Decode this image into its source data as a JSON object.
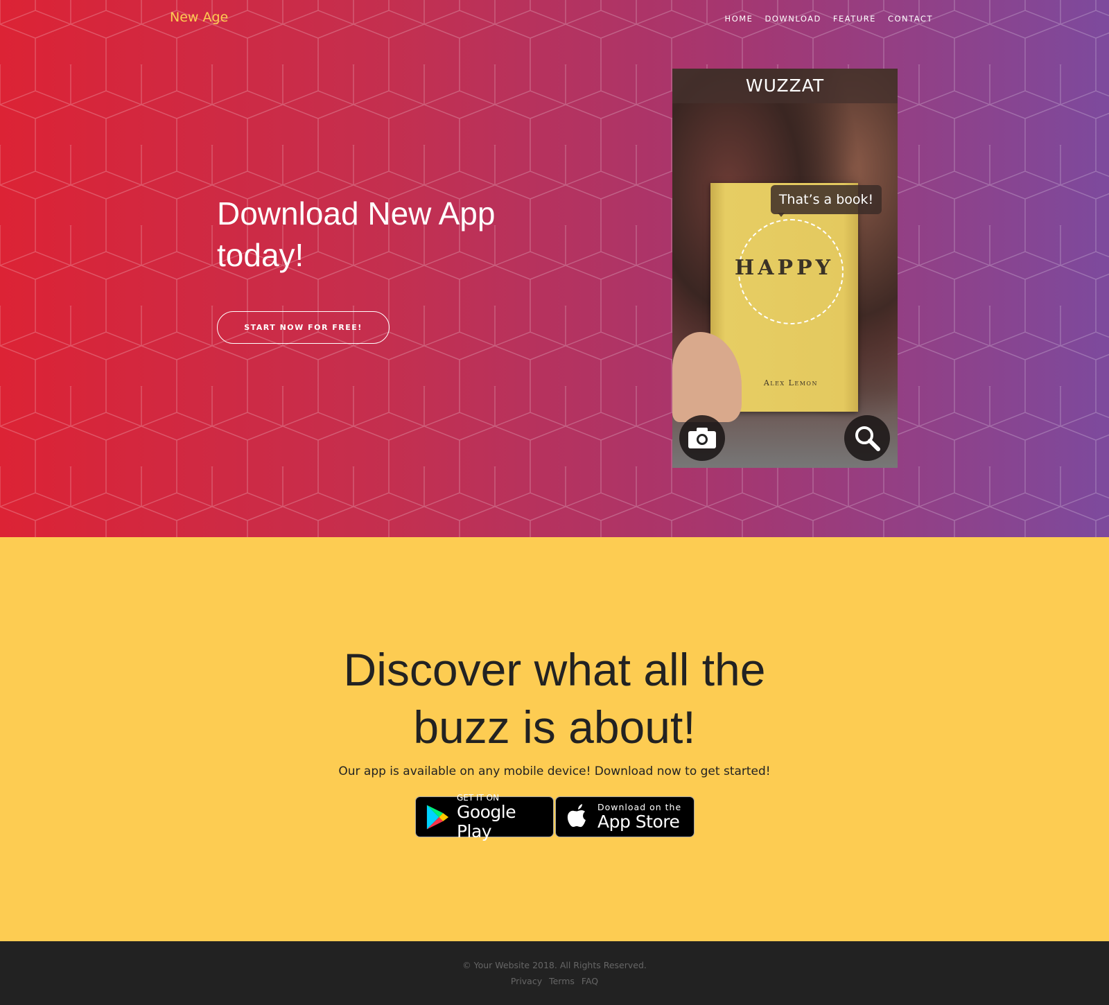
{
  "nav": {
    "brand": "New Age",
    "links": [
      "Home",
      "Download",
      "Feature",
      "Contact"
    ]
  },
  "hero": {
    "heading": "Download New App today!",
    "cta": "Start Now for Free!",
    "phone": {
      "app_name": "WUZZAT",
      "bubble": "That’s a book!",
      "book_title": "HAPPY",
      "book_author": "Alex Lemon"
    }
  },
  "download": {
    "heading": "Discover what all the buzz is about!",
    "text": "Our app is available on any mobile device! Download now to get started!",
    "google": {
      "small": "GET IT ON",
      "big": "Google Play"
    },
    "apple": {
      "small": "Download on the",
      "big": "App Store"
    }
  },
  "footer": {
    "copyright": "© Your Website 2018. All Rights Reserved.",
    "links": [
      "Privacy",
      "Terms",
      "FAQ"
    ]
  }
}
